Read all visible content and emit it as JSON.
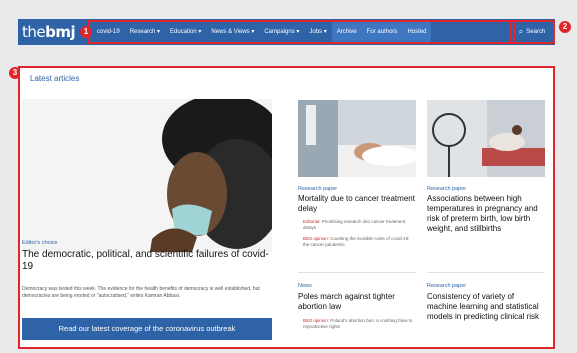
{
  "header": {
    "logo": {
      "thin": "the",
      "bold": "bmj"
    },
    "nav": [
      {
        "label": "covid-19",
        "highlight": false
      },
      {
        "label": "Research ▾",
        "highlight": false
      },
      {
        "label": "Education ▾",
        "highlight": false
      },
      {
        "label": "News & Views ▾",
        "highlight": false
      },
      {
        "label": "Campaigns ▾",
        "highlight": false
      },
      {
        "label": "Jobs ▾",
        "highlight": false
      },
      {
        "label": "Archive",
        "highlight": true
      },
      {
        "label": "For authors",
        "highlight": true
      },
      {
        "label": "Hosted",
        "highlight": true
      }
    ],
    "search_label": "Search"
  },
  "badges": [
    "1",
    "2",
    "3"
  ],
  "section_title": "Latest articles",
  "featured": {
    "label": "Editor's choice",
    "title": "The democratic, political, and scientific failures of covid-19",
    "text": "Democracy was tested this week. The evidence for the health benefits of democracy is well established, but democracies are being eroded or \"autocratised,\" writes Kamran Abbasi.",
    "cta": "Read our latest coverage of the coronavirus outbreak"
  },
  "cards": [
    {
      "label": "Research paper",
      "title": "Mortality due to cancer treatment delay",
      "desc_lead": "Editorial:",
      "desc": "Prioritising research into cancer treatment delays",
      "desc2_lead": "BMJ opinion:",
      "desc2": "Counting the invisible costs of covid-19: the cancer pandemic"
    },
    {
      "label": "Research paper",
      "title": "Associations between high temperatures in pregnancy and risk of preterm birth, low birth weight, and stillbirths",
      "desc_lead": "",
      "desc": "",
      "desc2_lead": "",
      "desc2": ""
    },
    {
      "label": "News",
      "title": "Poles march against tighter abortion law",
      "desc_lead": "",
      "desc": "",
      "desc2_lead": "BMJ opinion:",
      "desc2": "Poland's abortion ban: a crushing blow to reproductive rights"
    },
    {
      "label": "Research paper",
      "title": "Consistency of variety of machine learning and statistical models in predicting clinical risk",
      "desc_lead": "",
      "desc": "",
      "desc2_lead": "",
      "desc2": ""
    }
  ]
}
